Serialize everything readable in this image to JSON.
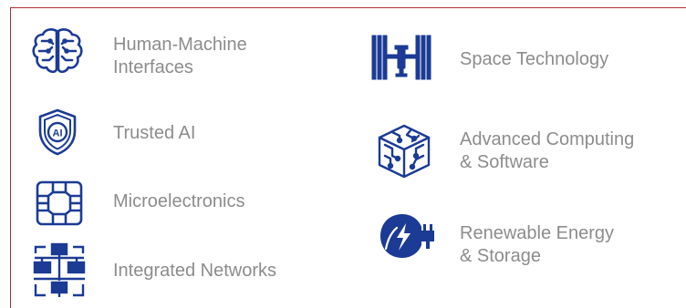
{
  "accent_color": "#1b3b94",
  "border_color": "#b52a35",
  "text_color": "#8c8c8c",
  "left_column": [
    {
      "icon": "brain-circuit-icon",
      "lines": [
        "Human-Machine",
        "Interfaces"
      ]
    },
    {
      "icon": "ai-shield-icon",
      "lines": [
        "Trusted AI"
      ]
    },
    {
      "icon": "microchip-icon",
      "lines": [
        "Microelectronics"
      ]
    },
    {
      "icon": "network-icon",
      "lines": [
        "Integrated Networks"
      ]
    }
  ],
  "right_column": [
    {
      "icon": "satellite-icon",
      "lines": [
        "Space Technology"
      ]
    },
    {
      "icon": "circuit-cube-icon",
      "lines": [
        "Advanced Computing",
        "& Software"
      ]
    },
    {
      "icon": "leaf-plug-icon",
      "lines": [
        "Renewable Energy",
        "& Storage"
      ]
    }
  ],
  "ai_badge": "AI"
}
